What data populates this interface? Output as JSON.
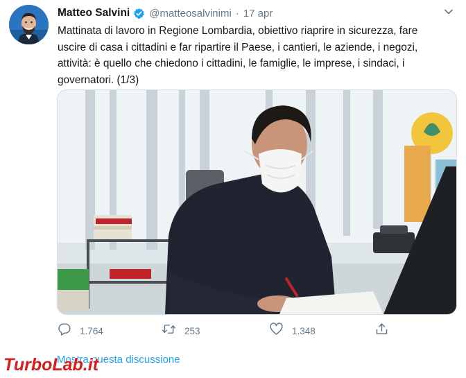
{
  "tweet": {
    "author_name": "Matteo Salvini",
    "handle": "@matteosalvinimi",
    "separator": "·",
    "date": "17 apr",
    "text_lines": [
      "Mattinata di lavoro in Regione Lombardia, obiettivo riaprire in sicurezza, fare",
      "uscire di casa i cittadini e far ripartire il Paese, i cantieri, le aziende, i negozi,",
      "attività: è quello che chiedono i cittadini, le famiglie, le imprese, i sindaci, i",
      "governatori. (1/3)"
    ],
    "actions": {
      "replies": "1.764",
      "retweets": "253",
      "likes": "1.348"
    },
    "thread_link": "Mostra questa discussione"
  },
  "icons": {
    "verified": "verified-badge-icon",
    "menu": "chevron-down-icon",
    "reply": "reply-icon",
    "retweet": "retweet-icon",
    "like": "heart-icon",
    "share": "share-icon"
  },
  "colors": {
    "accent": "#1da1f2",
    "muted": "#657786",
    "text": "#14171a"
  },
  "watermark": "TurboLab.it"
}
